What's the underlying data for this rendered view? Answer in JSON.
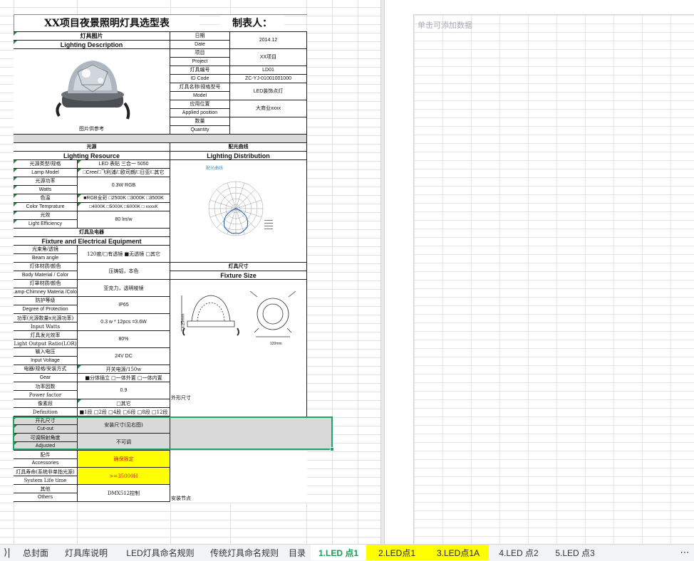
{
  "form": {
    "title": "XX项目夜景照明灯具选型表",
    "author_label": "制表人：",
    "photo_header_cn": "灯具图片",
    "photo_header_en": "Lighting Description",
    "photo_note": "图片供参考",
    "info": [
      {
        "cn": "日期",
        "en": "Date",
        "value": "2014.12"
      },
      {
        "cn": "项目",
        "en": "Project",
        "value": "XX项目"
      },
      {
        "cn": "灯具编号",
        "en": "ID Code",
        "value": "LD01",
        "value2": "ZC-YJ-01001001000"
      },
      {
        "cn": "灯具名称/规格型号",
        "en": "Model",
        "value": "LED装饰点灯"
      },
      {
        "cn": "应用位置",
        "en": "Applied position",
        "value": "大商业xxxx"
      },
      {
        "cn": "数量",
        "en": "Quantity",
        "value": ""
      }
    ],
    "source_header_cn": "光源",
    "source_header_en": "Lighting Resource",
    "dist_header_cn": "配光曲线",
    "dist_header_en": "Lighting Distribution",
    "dist_caption": "配光曲线",
    "source_rows": [
      {
        "cn": "光源类型/规格",
        "en": "Lamp Model",
        "value": "LED 表贴 三合一 5050",
        "value2": "□Cree/□飞利浦/□欧司朗/□日亚/□其它"
      },
      {
        "cn": "光源功率",
        "en": "Watts",
        "value": "0.3W RGB"
      },
      {
        "cn": "色温",
        "en": "Color Temprature",
        "value": "■RGB全彩 □2500K □3000K □3500K",
        "value2": "□4000K □5000K □6000K □ xxxxK"
      },
      {
        "cn": "光效",
        "en": "Light Efficiency",
        "value": "80 lm/w"
      }
    ],
    "fixture_header_cn": "灯具及电器",
    "fixture_header_en": "Fixture and Electrical Equipment",
    "fixture_rows": [
      {
        "cn": "光束角/透镜",
        "en": "Beam angle",
        "value": "120度/□有透镜 ■无透镜 □其它"
      },
      {
        "cn": "灯体材质/颜色",
        "en": "Body Material / Color",
        "value": "压铸铝，本色"
      },
      {
        "cn": "灯罩材质/颜色",
        "en": "Lamp-Chimney Materia /Color",
        "value": "亚克力，透明棱镜"
      },
      {
        "cn": "防护等级",
        "en": "Degree of Protection",
        "value": "IP65"
      },
      {
        "cn": "功率(光源数量x光源功率)",
        "en": "Input Watts",
        "value": "0.3 w * 12pcs =3.6W"
      },
      {
        "cn": "灯具发光效率",
        "en": "Light Output Ratio(LOR)",
        "value": "80%"
      },
      {
        "cn": "输入电压",
        "en": "Input Voltage",
        "value": "24V DC"
      },
      {
        "cn": "电器/规格/安装方式",
        "en": "Gear",
        "value": "开关电源/150w",
        "value2": "■分体插立 □一体外置 □一体内置"
      },
      {
        "cn": "功率因数",
        "en": "Power factor",
        "value": "0.9"
      },
      {
        "cn": "像素段",
        "en": "Definition",
        "value": "□其它",
        "value2": "■1段 □2段 □4段 □6段 □8段 □12段"
      }
    ],
    "size_header_cn": "灯具尺寸",
    "size_header_en": "Fixture Size",
    "size_caption": "外形尺寸",
    "dim_label": "73.25mm",
    "dim_label2": "120mm",
    "gray_rows": [
      {
        "cn": "开孔尺寸",
        "en": "Cut-out",
        "value": "安装尺寸(见右图)"
      },
      {
        "cn": "可调照射角度",
        "en": "Adjusted",
        "value": "不可调"
      }
    ],
    "bottom_rows": [
      {
        "cn": "配件",
        "en": "Accessories",
        "value": "确保限定"
      },
      {
        "cn": "灯具寿命(系统非单指光源)",
        "en": "System Life time",
        "value": ">=35000H"
      },
      {
        "cn": "其他",
        "en": "Others",
        "value": "DMX512控制"
      }
    ],
    "install_caption": "安装节点"
  },
  "right_pane": {
    "placeholder": "单击可添加数据"
  },
  "tabs": [
    {
      "label": "总封面"
    },
    {
      "label": "灯具库说明"
    },
    {
      "label": "LED灯具命名规则"
    },
    {
      "label": "传统灯具命名规则"
    },
    {
      "label": "目录"
    },
    {
      "label": "1.LED 点1",
      "state": "active"
    },
    {
      "label": "2.LED点1",
      "state": "yellow"
    },
    {
      "label": "3.LED点1A",
      "state": "yellow"
    },
    {
      "label": "4.LED 点2"
    },
    {
      "label": "5.LED 点3"
    }
  ],
  "tab_nav": {
    "last": "⟩|",
    "more": "⋯"
  },
  "colors": {
    "accent": "#21a366",
    "highlight": "#ffff00"
  }
}
